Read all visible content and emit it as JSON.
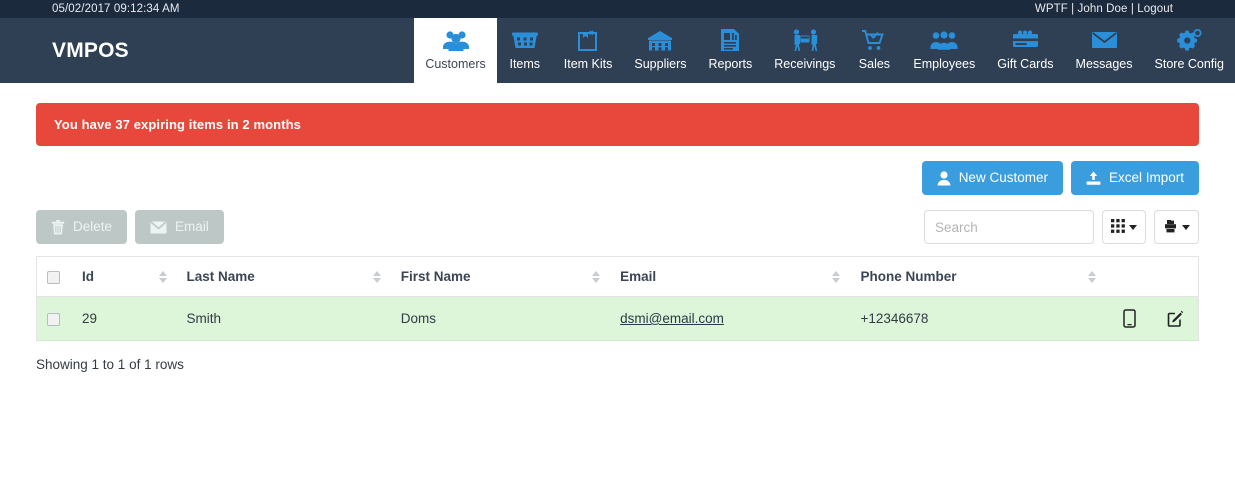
{
  "topbar": {
    "datetime": "05/02/2017 09:12:34 AM",
    "account": "WPTF | John Doe | Logout"
  },
  "brand": {
    "title": "VMPOS"
  },
  "nav": {
    "items": [
      {
        "label": "Customers",
        "icon": "customers-icon",
        "active": true
      },
      {
        "label": "Items",
        "icon": "items-icon",
        "active": false
      },
      {
        "label": "Item Kits",
        "icon": "item-kits-icon",
        "active": false
      },
      {
        "label": "Suppliers",
        "icon": "suppliers-icon",
        "active": false
      },
      {
        "label": "Reports",
        "icon": "reports-icon",
        "active": false
      },
      {
        "label": "Receivings",
        "icon": "receivings-icon",
        "active": false
      },
      {
        "label": "Sales",
        "icon": "sales-icon",
        "active": false
      },
      {
        "label": "Employees",
        "icon": "employees-icon",
        "active": false
      },
      {
        "label": "Gift Cards",
        "icon": "gift-cards-icon",
        "active": false
      },
      {
        "label": "Messages",
        "icon": "messages-icon",
        "active": false
      },
      {
        "label": "Store Config",
        "icon": "store-config-icon",
        "active": false
      }
    ]
  },
  "alert": {
    "message": "You have 37 expiring items in 2 months",
    "color": "#e8483c"
  },
  "actions": {
    "new_customer_label": "New Customer",
    "excel_import_label": "Excel Import",
    "primary_color": "#3a9ede"
  },
  "toolbar": {
    "delete_label": "Delete",
    "email_label": "Email",
    "disabled_color": "#bdc8c6",
    "search_placeholder": "Search",
    "search_value": "",
    "columns_button": "columns-grid-icon",
    "export_button": "export-icon"
  },
  "table": {
    "columns": [
      {
        "label": "Id",
        "sortable": true
      },
      {
        "label": "Last Name",
        "sortable": true
      },
      {
        "label": "First Name",
        "sortable": true
      },
      {
        "label": "Email",
        "sortable": true
      },
      {
        "label": "Phone Number",
        "sortable": true
      }
    ],
    "rows": [
      {
        "id": "29",
        "last_name": "Smith",
        "first_name": "Doms",
        "email": "dsmi@email.com",
        "phone": "+12346678",
        "row_color": "#ddf5d8"
      }
    ],
    "footer": "Showing 1 to 1 of 1 rows"
  }
}
